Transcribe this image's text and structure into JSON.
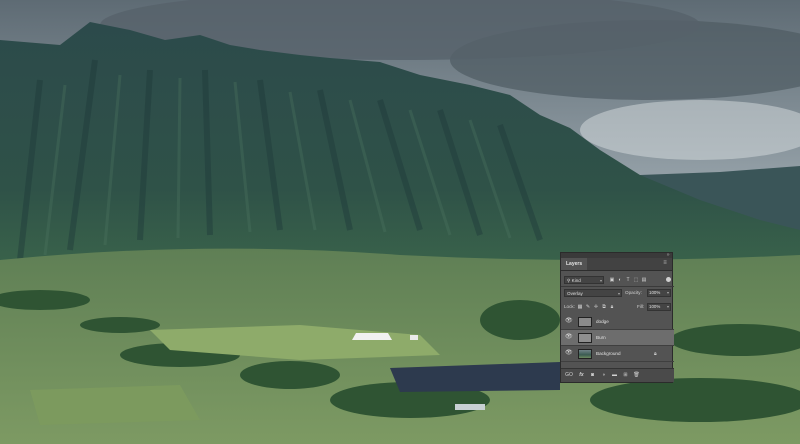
{
  "panel": {
    "tab_label": "Layers",
    "menu_icon": "menu-icon",
    "filter": {
      "kind_label": "Kind"
    },
    "blend_mode": "Overlay",
    "opacity_label": "Opacity:",
    "opacity_value": "100%",
    "lock_label": "Lock:",
    "fill_label": "Fill:",
    "fill_value": "100%",
    "layers": [
      {
        "name": "dodge",
        "selected": false
      },
      {
        "name": "Burn",
        "selected": true
      },
      {
        "name": "Background",
        "selected": false,
        "locked": true
      }
    ],
    "bottom_link_label": "GO",
    "bottom_fx_label": "fx"
  }
}
